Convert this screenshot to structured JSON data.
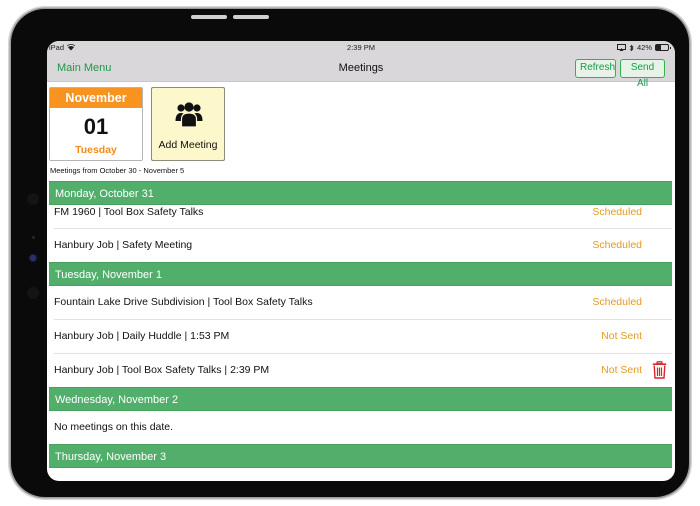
{
  "status_bar": {
    "device": "iPad",
    "time": "2:39 PM",
    "battery_percent": "42%",
    "battery_level": 0.42,
    "icons": [
      "wifi-icon",
      "screen-mirror-icon",
      "bluetooth-icon",
      "battery-icon"
    ]
  },
  "nav": {
    "back_label": "Main Menu",
    "title": "Meetings",
    "refresh_label": "Refresh",
    "send_all_label": "Send All",
    "accent_color": "#1a9a4a"
  },
  "calendar": {
    "month": "November",
    "day": "01",
    "weekday": "Tuesday",
    "header_color": "#f7931e"
  },
  "add_meeting": {
    "label": "Add Meeting",
    "icon": "group-icon"
  },
  "range_label": "Meetings from October 30 - November 5",
  "sections": [
    {
      "date": "Monday, October 31",
      "meetings": [
        {
          "title": "FM 1960 | Tool Box Safety Talks",
          "status": "Scheduled"
        },
        {
          "title": "Hanbury Job | Safety Meeting",
          "status": "Scheduled"
        }
      ]
    },
    {
      "date": "Tuesday, November 1",
      "meetings": [
        {
          "title": "Fountain Lake Drive Subdivision | Tool Box Safety Talks",
          "status": "Scheduled"
        },
        {
          "title": "Hanbury Job | Daily Huddle | 1:53 PM",
          "status": "Not Sent"
        },
        {
          "title": "Hanbury Job | Tool Box Safety Talks | 2:39 PM",
          "status": "Not Sent",
          "deletable": true
        }
      ]
    },
    {
      "date": "Wednesday, November 2",
      "empty_message": "No meetings on this date."
    },
    {
      "date": "Thursday, November 3"
    }
  ],
  "colors": {
    "section_header": "#52ae6b",
    "status_text": "#e59a1f",
    "delete_icon": "#d9262b"
  }
}
